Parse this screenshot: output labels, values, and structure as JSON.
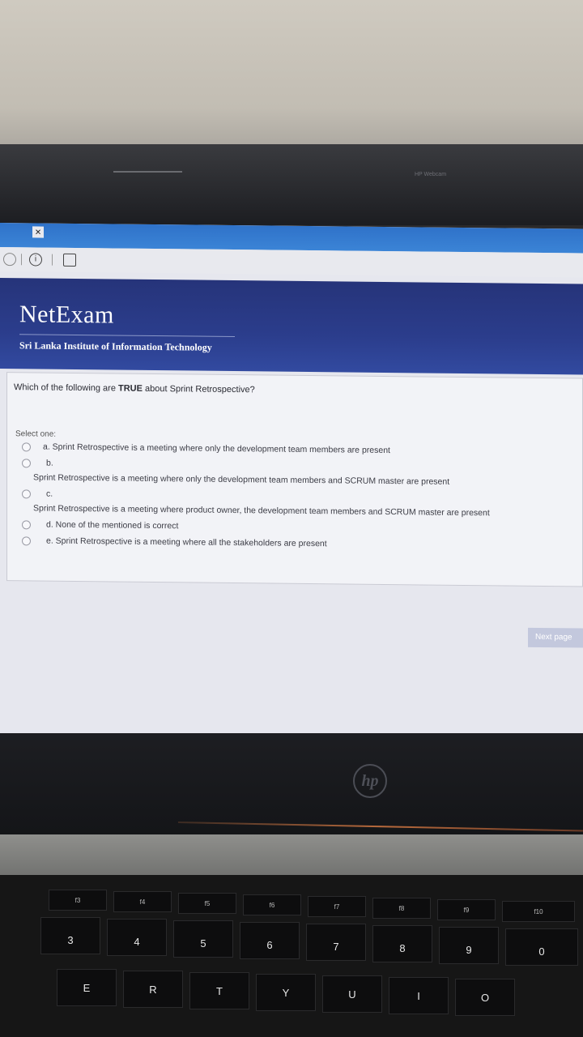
{
  "webcam_label": "HP Webcam",
  "browser": {
    "close_tab": "×",
    "info_icon": "i"
  },
  "header": {
    "title": "NetExam",
    "subtitle": "Sri Lanka Institute of Information Technology"
  },
  "quiz": {
    "question_prefix": "Which of the following are ",
    "question_bold": "TRUE",
    "question_suffix": " about Sprint Retrospective?",
    "select_one": "Select one:",
    "options": [
      {
        "label": "a. Sprint Retrospective is a meeting where only the development team members are present"
      },
      {
        "letter": "b.",
        "label": "Sprint Retrospective is a meeting where only the development team members and SCRUM master are present"
      },
      {
        "letter": "c.",
        "label": "Sprint Retrospective is a meeting where product owner, the development team members and SCRUM master are present"
      },
      {
        "label": "d. None of the mentioned is correct"
      },
      {
        "label": "e. Sprint Retrospective is a meeting where all the stakeholders are present"
      }
    ],
    "next_button": "Next page"
  },
  "laptop": {
    "brand": "hp"
  },
  "keyboard": {
    "function_row": [
      "f3",
      "f4",
      "f5",
      "f6",
      "f7",
      "f8",
      "f9",
      "f10"
    ],
    "number_row": [
      "3",
      "4",
      "5",
      "6",
      "7",
      "8",
      "9",
      "0"
    ],
    "number_symbols": [
      "#",
      "$",
      "%",
      "^",
      "&",
      "*",
      "(",
      ")"
    ],
    "letter_row": [
      "E",
      "R",
      "T",
      "Y",
      "U",
      "I",
      "O"
    ]
  }
}
